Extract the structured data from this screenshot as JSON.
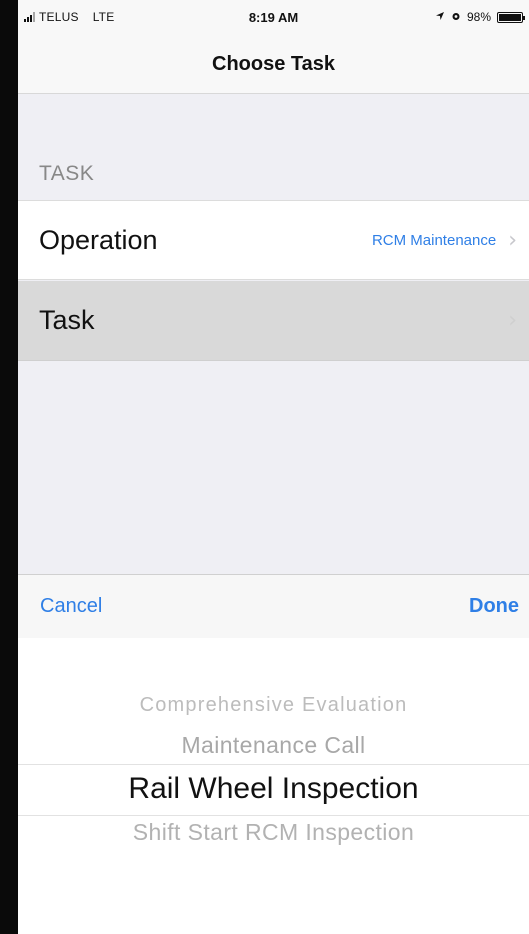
{
  "status_bar": {
    "carrier": "TELUS",
    "network": "LTE",
    "time": "8:19 AM",
    "location_icon": "location-arrow-icon",
    "alarm_icon": "alarm-clock-icon",
    "battery_percent": "98%",
    "battery_level": 0.98
  },
  "nav": {
    "title": "Choose Task"
  },
  "section": {
    "header": "TASK"
  },
  "rows": [
    {
      "label": "Operation",
      "value": "RCM Maintenance",
      "chevron": "chevron-right-icon"
    },
    {
      "label": "Task",
      "value": "",
      "chevron": "chevron-right-icon"
    }
  ],
  "picker_toolbar": {
    "cancel_label": "Cancel",
    "done_label": "Done"
  },
  "picker": {
    "options": [
      "Comprehensive Evaluation",
      "Maintenance Call",
      "Rail Wheel Inspection",
      "Shift Start RCM Inspection"
    ],
    "selected": "Rail Wheel Inspection"
  },
  "colors": {
    "accent": "#2f7fe6",
    "background": "#efeff4",
    "selected_row": "#d9d9d9"
  }
}
